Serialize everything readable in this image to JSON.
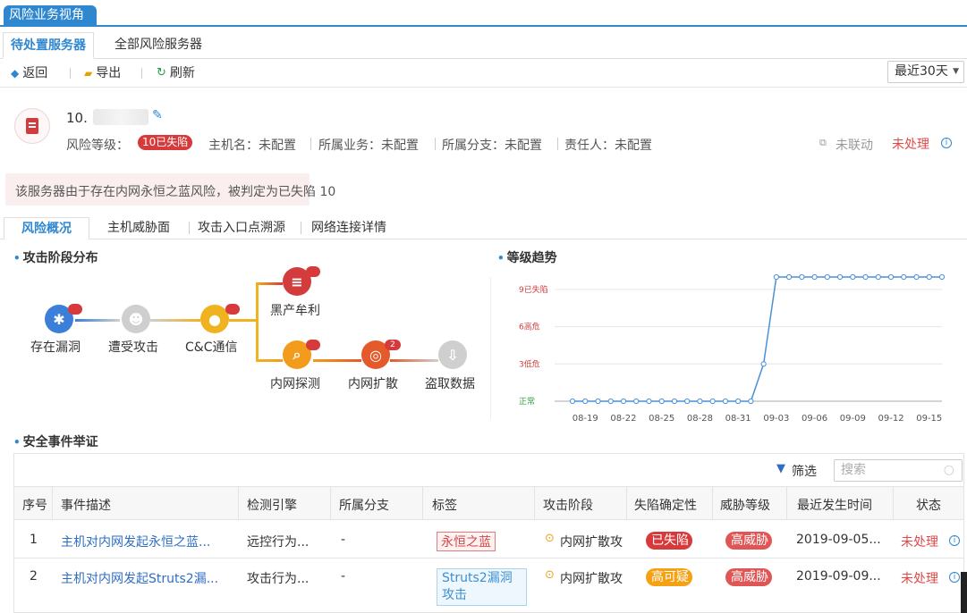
{
  "window": {
    "tab_title": "风险业务视角"
  },
  "subtabs": [
    {
      "label": "待处置服务器"
    },
    {
      "label": "全部风险服务器"
    }
  ],
  "toolbar": {
    "back": "返回",
    "export": "导出",
    "refresh": "刷新",
    "range": "最近30天"
  },
  "server": {
    "ip": "10.",
    "risk_label": "风险等级：",
    "risk_badge": "10已失陷",
    "host_label": "主机名：未配置",
    "biz_label": "所属业务：未配置",
    "branch_label": "所属分支：未配置",
    "owner_label": "责任人：未配置",
    "link_status": "未联动",
    "process_status": "未处理",
    "alert": "该服务器由于存在内网永恒之蓝风险，被判定为已失陷 10"
  },
  "content_tabs": [
    {
      "label": "风险概况"
    },
    {
      "label": "主机威胁面"
    },
    {
      "label": "攻击入口点溯源"
    },
    {
      "label": "网络连接详情"
    }
  ],
  "sections": {
    "attack_stage": "攻击阶段分布",
    "level_trend": "等级趋势",
    "events": "安全事件举证"
  },
  "attack_flow": {
    "nodes": [
      {
        "label": "存在漏洞",
        "badge": "",
        "color": "#3b7fd8"
      },
      {
        "label": "遭受攻击",
        "badge": "",
        "color": "#cfcfcf"
      },
      {
        "label": "C&C通信",
        "badge": "",
        "color": "#f0b21f"
      },
      {
        "label": "黑产牟利",
        "badge": "",
        "color": "#d33c3c"
      },
      {
        "label": "内网探测",
        "badge": "",
        "color": "#f39c1c"
      },
      {
        "label": "内网扩散",
        "badge": "2",
        "color": "#e45a2a"
      },
      {
        "label": "盗取数据",
        "badge": "",
        "color": "#cfcfcf"
      }
    ]
  },
  "chart_data": {
    "type": "line",
    "title": "等级趋势",
    "x": [
      "08-18",
      "08-19",
      "08-20",
      "08-21",
      "08-22",
      "08-23",
      "08-24",
      "08-25",
      "08-26",
      "08-27",
      "08-28",
      "08-29",
      "08-30",
      "08-31",
      "09-01",
      "09-02",
      "09-03",
      "09-04",
      "09-05",
      "09-06",
      "09-07",
      "09-08",
      "09-09",
      "09-10",
      "09-11",
      "09-12",
      "09-13",
      "09-14",
      "09-15",
      "09-16"
    ],
    "x_ticks": [
      "08-19",
      "08-22",
      "08-25",
      "08-28",
      "08-31",
      "09-03",
      "09-06",
      "09-09",
      "09-12",
      "09-15"
    ],
    "values": [
      0,
      0,
      0,
      0,
      0,
      0,
      0,
      0,
      0,
      0,
      0,
      0,
      0,
      0,
      0,
      3,
      10,
      10,
      10,
      10,
      10,
      10,
      10,
      10,
      10,
      10,
      10,
      10,
      10,
      10
    ],
    "y_ticks": [
      {
        "value": 0,
        "label": "正常"
      },
      {
        "value": 3,
        "label": "3低危"
      },
      {
        "value": 6,
        "label": "6高危"
      },
      {
        "value": 9,
        "label": "9已失陷"
      }
    ],
    "ylim": [
      0,
      10
    ],
    "colors": {
      "line": "#4a90d9",
      "tick_text": "#d23c3c",
      "normal_text": "#3a9b4a"
    }
  },
  "filter": {
    "label": "筛选",
    "search_placeholder": "搜索"
  },
  "table": {
    "headers": [
      "序号",
      "事件描述",
      "检测引擎",
      "所属分支",
      "标签",
      "攻击阶段",
      "失陷确定性",
      "威胁等级",
      "最近发生时间",
      "状态"
    ],
    "rows": [
      {
        "no": "1",
        "desc": "主机对内网发起永恒之蓝...",
        "engine": "远控行为...",
        "branch": "-",
        "tag": "永恒之蓝",
        "stage": "内网扩散攻",
        "certainty": "已失陷",
        "threat": "高威胁",
        "time": "2019-09-05...",
        "status": "未处理"
      },
      {
        "no": "2",
        "desc": "主机对内网发起Struts2漏...",
        "engine": "攻击行为...",
        "branch": "-",
        "tag": "Struts2漏洞攻击",
        "stage": "内网扩散攻",
        "certainty": "高可疑",
        "threat": "高威胁",
        "time": "2019-09-09...",
        "status": "未处理"
      }
    ]
  }
}
